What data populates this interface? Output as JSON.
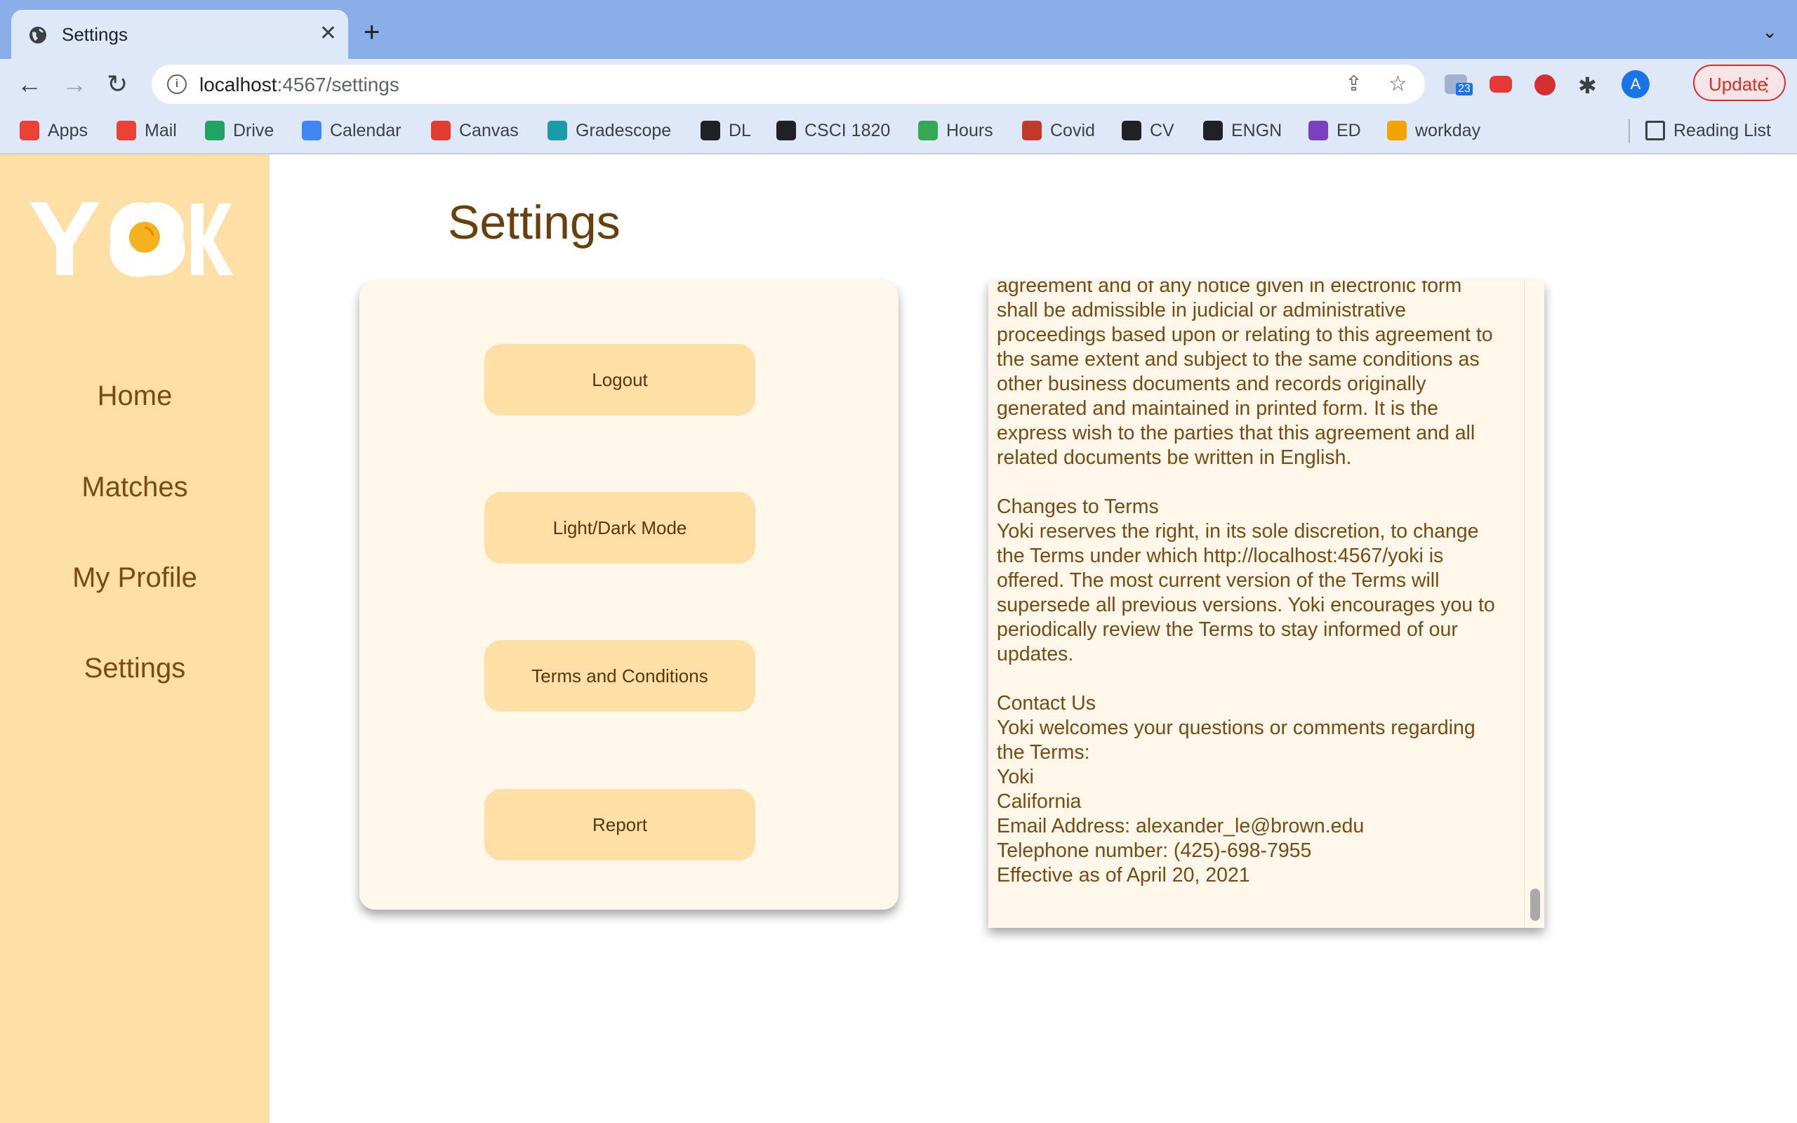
{
  "browser": {
    "tab_title": "Settings",
    "tab_close": "✕",
    "new_tab": "+",
    "tab_menu": "⌄",
    "url_host": "localhost",
    "url_path": ":4567/settings",
    "update_label": "Update",
    "avatar_letter": "A",
    "mail_badge": "23",
    "bookmarks": [
      {
        "label": "Apps",
        "color": "#ea4335"
      },
      {
        "label": "Mail",
        "color": "#ea4335"
      },
      {
        "label": "Drive",
        "color": "#1fa463"
      },
      {
        "label": "Calendar",
        "color": "#4285f4"
      },
      {
        "label": "Canvas",
        "color": "#e03c31"
      },
      {
        "label": "Gradescope",
        "color": "#1b9aaa"
      },
      {
        "label": "DL",
        "color": "#202124"
      },
      {
        "label": "CSCI 1820",
        "color": "#202124"
      },
      {
        "label": "Hours",
        "color": "#34a853"
      },
      {
        "label": "Covid",
        "color": "#c0392b"
      },
      {
        "label": "CV",
        "color": "#202124"
      },
      {
        "label": "ENGN",
        "color": "#202124"
      },
      {
        "label": "ED",
        "color": "#7b3fbf"
      },
      {
        "label": "workday",
        "color": "#f4a300"
      }
    ],
    "reading_list": "Reading List"
  },
  "sidebar": {
    "logo_text": "YOKI",
    "items": [
      {
        "label": "Home"
      },
      {
        "label": "Matches"
      },
      {
        "label": "My Profile"
      },
      {
        "label": "Settings"
      }
    ]
  },
  "main": {
    "title": "Settings",
    "buttons": [
      {
        "label": "Logout"
      },
      {
        "label": "Light/Dark Mode"
      },
      {
        "label": "Terms and Conditions"
      },
      {
        "label": "Report"
      }
    ],
    "terms_text": "agreement and of any notice given in electronic form\nshall be admissible in judicial or administrative\nproceedings based upon or relating to this agreement to\nthe same extent and subject to the same conditions as\nother business documents and records originally\ngenerated and maintained in printed form. It is the\nexpress wish to the parties that this agreement and all\nrelated documents be written in English.\n\nChanges to Terms\nYoki reserves the right, in its sole discretion, to change\nthe Terms under which http://localhost:4567/yoki is\noffered. The most current version of the Terms will\nsupersede all previous versions. Yoki encourages you to\nperiodically review the Terms to stay informed of our\nupdates.\n\nContact Us\nYoki welcomes your questions or comments regarding\nthe Terms:\nYoki\nCalifornia\nEmail Address: alexander_le@brown.edu\nTelephone number: (425)-698-7955\nEffective as of April 20, 2021"
  },
  "colors": {
    "sidebar_bg": "#fedfa5",
    "card_bg": "#fff7ea",
    "accent_text": "#7a4a12",
    "egg_yolk": "#f5b21e"
  }
}
